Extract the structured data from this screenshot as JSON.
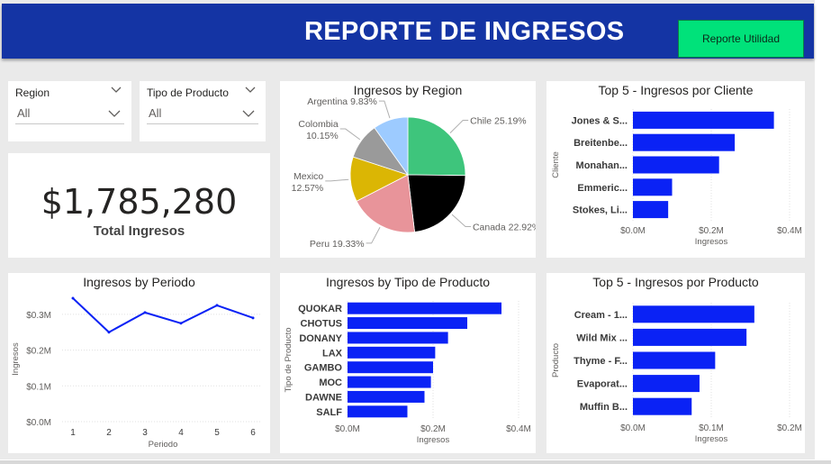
{
  "header": {
    "title": "REPORTE DE INGRESOS",
    "button_label": "Reporte Utilidad"
  },
  "slicers": [
    {
      "label": "Region",
      "value": "All"
    },
    {
      "label": "Tipo de Producto",
      "value": "All"
    }
  ],
  "kpi": {
    "value": "$1,785,280",
    "label": "Total Ingresos"
  },
  "colors": {
    "header_bg": "#1434a4",
    "button_bg": "#00e27a",
    "bar": "#0a22f5",
    "line": "#0a22f5",
    "pie": [
      "#3ec57c",
      "#000000",
      "#e8949a",
      "#dbb604",
      "#9a9a9a",
      "#9dcbff"
    ]
  },
  "chart_data": [
    {
      "id": "region",
      "type": "pie",
      "title": "Ingresos by Region",
      "labels": [
        "Chile",
        "Canada",
        "Peru",
        "Mexico",
        "Colombia",
        "Argentina"
      ],
      "values": [
        25.19,
        22.92,
        19.33,
        12.57,
        10.15,
        9.83
      ],
      "value_labels": [
        "25.19%",
        "22.92%",
        "19.33%",
        "12.57%",
        "10.15%",
        "9.83%"
      ]
    },
    {
      "id": "cliente",
      "type": "bar",
      "orientation": "horizontal",
      "title": "Top 5 - Ingresos por Cliente",
      "categories": [
        "Jones & S...",
        "Breitenbe...",
        "Monahan...",
        "Emmeric...",
        "Stokes, Li..."
      ],
      "values": [
        0.36,
        0.26,
        0.22,
        0.1,
        0.09
      ],
      "xlabel": "Ingresos",
      "ylabel": "Cliente",
      "xlim": [
        0,
        0.4
      ],
      "ticks": [
        0,
        0.2,
        0.4
      ],
      "tick_labels": [
        "$0.0M",
        "$0.2M",
        "$0.4M"
      ],
      "grid": true
    },
    {
      "id": "periodo",
      "type": "line",
      "title": "Ingresos by Periodo",
      "x": [
        1,
        2,
        3,
        4,
        5,
        6
      ],
      "y": [
        0.345,
        0.25,
        0.305,
        0.275,
        0.325,
        0.29
      ],
      "xlabel": "Periodo",
      "ylabel": "Ingresos",
      "ylim": [
        0,
        0.35
      ],
      "yticks": [
        0,
        0.1,
        0.2,
        0.3
      ],
      "ytick_labels": [
        "$0.0M",
        "$0.1M",
        "$0.2M",
        "$0.3M"
      ],
      "grid": true
    },
    {
      "id": "tipo",
      "type": "bar",
      "orientation": "horizontal",
      "title": "Ingresos by Tipo de Producto",
      "categories": [
        "QUOKAR",
        "CHOTUS",
        "DONANY",
        "LAX",
        "GAMBO",
        "MOC",
        "DAWNE",
        "SALF"
      ],
      "values": [
        0.36,
        0.28,
        0.235,
        0.205,
        0.2,
        0.195,
        0.18,
        0.14
      ],
      "xlabel": "Ingresos",
      "ylabel": "Tipo de Producto",
      "xlim": [
        0,
        0.4
      ],
      "ticks": [
        0,
        0.2,
        0.4
      ],
      "tick_labels": [
        "$0.0M",
        "$0.2M",
        "$0.4M"
      ],
      "grid": true
    },
    {
      "id": "producto",
      "type": "bar",
      "orientation": "horizontal",
      "title": "Top 5 - Ingresos por Producto",
      "categories": [
        "Cream - 1...",
        "Wild Mix ...",
        "Thyme - F...",
        "Evaporat...",
        "Muffin B..."
      ],
      "values": [
        0.155,
        0.145,
        0.105,
        0.085,
        0.075
      ],
      "xlabel": "Ingresos",
      "ylabel": "Producto",
      "xlim": [
        0,
        0.2
      ],
      "ticks": [
        0,
        0.1,
        0.2
      ],
      "tick_labels": [
        "$0.0M",
        "$0.1M",
        "$0.2M"
      ],
      "grid": true
    }
  ]
}
